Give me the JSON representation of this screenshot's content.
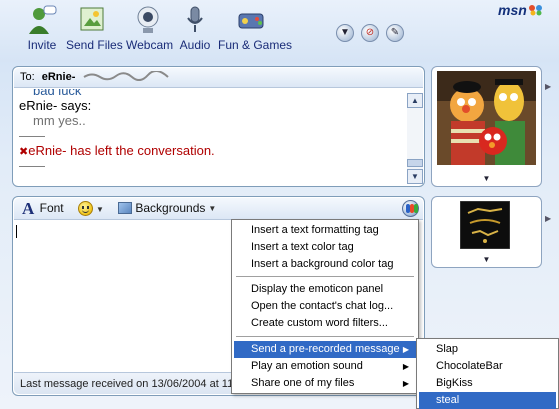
{
  "toolbar": {
    "items": [
      {
        "label": "Invite",
        "icon": "invite-icon"
      },
      {
        "label": "Send Files",
        "icon": "send-files-icon"
      },
      {
        "label": "Webcam",
        "icon": "webcam-icon"
      },
      {
        "label": "Audio",
        "icon": "audio-icon"
      },
      {
        "label": "Fun & Games",
        "icon": "fun-games-icon"
      }
    ],
    "round_buttons": [
      "down-arrow-icon",
      "block-icon",
      "pen-icon"
    ],
    "logo": "msn"
  },
  "conversation": {
    "to_label": "To:",
    "contact_name": "eRnie-",
    "lines": {
      "cut_text": "bad luck",
      "says": "eRnie- says:",
      "message": "mm yes..",
      "rule1": "——",
      "left_notice": "eRnie- has left the conversation.",
      "rule2": "——"
    }
  },
  "compose": {
    "font_label": "Font",
    "backgrounds_label": "Backgrounds",
    "status_text": "Last message received on 13/06/2004 at 11"
  },
  "context_menu": {
    "items": [
      {
        "label": "Insert a text formatting tag"
      },
      {
        "label": "Insert a text color tag"
      },
      {
        "label": "Insert a background color tag"
      },
      {
        "label": "Display the emoticon panel"
      },
      {
        "label": "Open the contact's chat log..."
      },
      {
        "label": "Create custom word filters..."
      },
      {
        "label": "Send a pre-recorded message"
      },
      {
        "label": "Play an emotion sound"
      },
      {
        "label": "Share one of my files"
      }
    ],
    "highlighted": "Send a pre-recorded message"
  },
  "submenu": {
    "items": [
      "Slap",
      "ChocolateBar",
      "BigKiss",
      "steal"
    ],
    "highlighted": "steal"
  },
  "colors": {
    "accent_blue": "#316ac5",
    "label_blue": "#1a2c78",
    "left_red": "#b00000",
    "panel_border": "#7f9db9"
  }
}
